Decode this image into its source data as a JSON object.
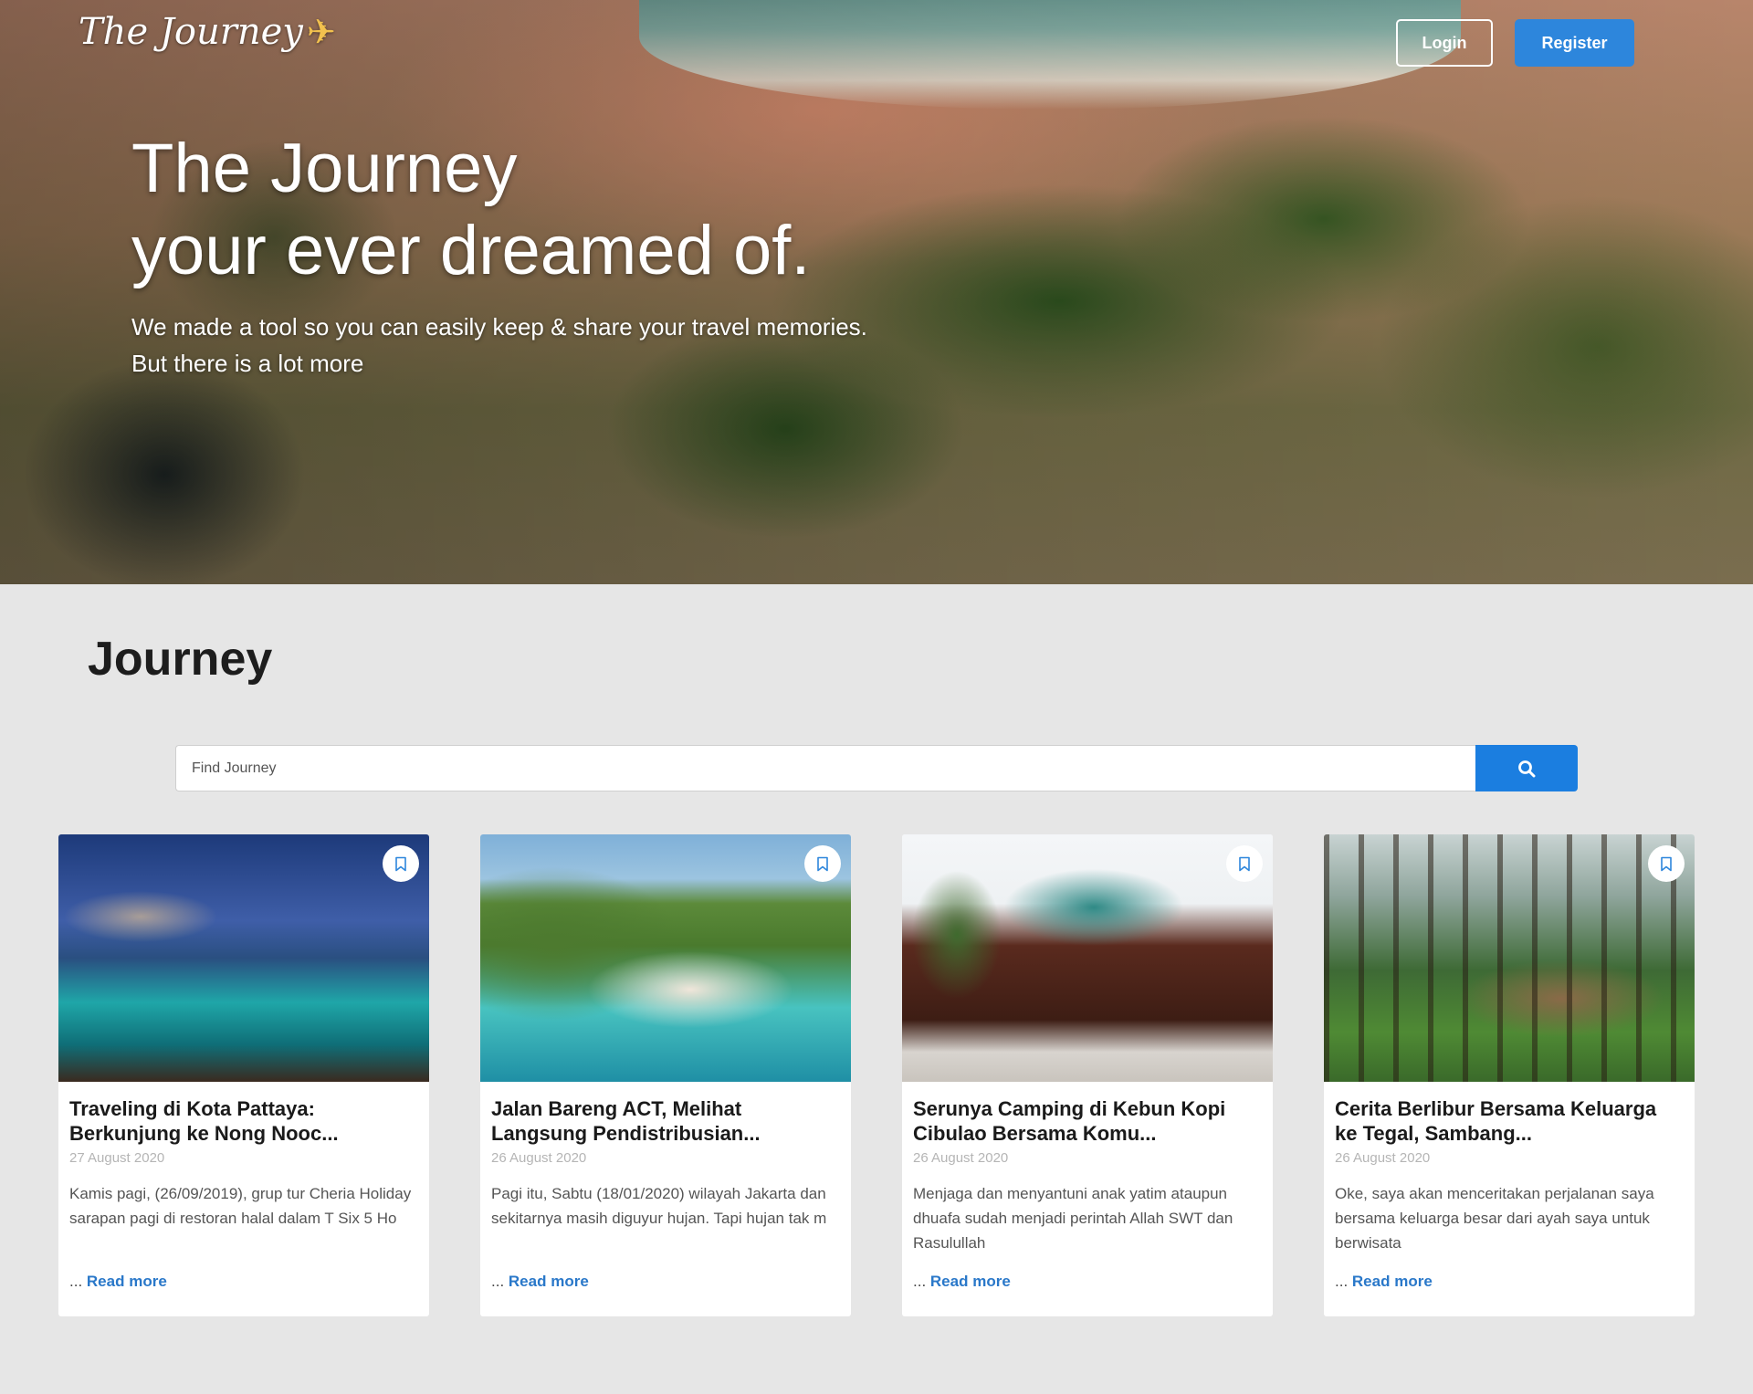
{
  "header": {
    "logo_text": "The Journey",
    "logo_icon": "map-icon",
    "login_label": "Login",
    "register_label": "Register"
  },
  "hero": {
    "title_line1": "The Journey",
    "title_line2": "your ever dreamed of.",
    "subtitle_line1": "We made a tool so you can easily keep & share your travel memories.",
    "subtitle_line2": "But there is a lot more"
  },
  "journey": {
    "section_title": "Journey",
    "search": {
      "placeholder": "Find Journey",
      "value": "",
      "button_icon": "search-icon"
    },
    "cards": [
      {
        "title": "Traveling di Kota Pattaya: Berkunjung ke Nong Nooc...",
        "date": "27 August 2020",
        "excerpt": "Kamis pagi, (26/09/2019), grup tur Cheria Holiday sarapan pagi di restoran halal dalam T Six 5 Ho",
        "ellipsis": "...",
        "read_more": "Read more",
        "bookmark_icon": "bookmark-icon"
      },
      {
        "title": "Jalan Bareng ACT, Melihat Langsung Pendistribusian...",
        "date": "26 August 2020",
        "excerpt": "Pagi itu, Sabtu (18/01/2020) wilayah Jakarta dan sekitarnya masih diguyur hujan. Tapi hujan tak m",
        "ellipsis": "...",
        "read_more": "Read more",
        "bookmark_icon": "bookmark-icon"
      },
      {
        "title": "Serunya Camping di Kebun Kopi Cibulao Bersama Komu...",
        "date": "26 August 2020",
        "excerpt": "Menjaga dan menyantuni anak yatim ataupun dhuafa sudah menjadi perintah Allah SWT dan Rasulullah",
        "ellipsis": "...",
        "read_more": "Read more",
        "bookmark_icon": "bookmark-icon"
      },
      {
        "title": "Cerita Berlibur Bersama Keluarga ke Tegal, Sambang...",
        "date": "26 August 2020",
        "excerpt": "Oke, saya akan menceritakan perjalanan saya bersama keluarga besar dari ayah saya untuk berwisata",
        "ellipsis": "...",
        "read_more": "Read more",
        "bookmark_icon": "bookmark-icon"
      }
    ]
  },
  "colors": {
    "primary": "#2d86dc",
    "search_button": "#1b7ee0",
    "link": "#2a78c9",
    "page_background": "#e6e6e6"
  }
}
